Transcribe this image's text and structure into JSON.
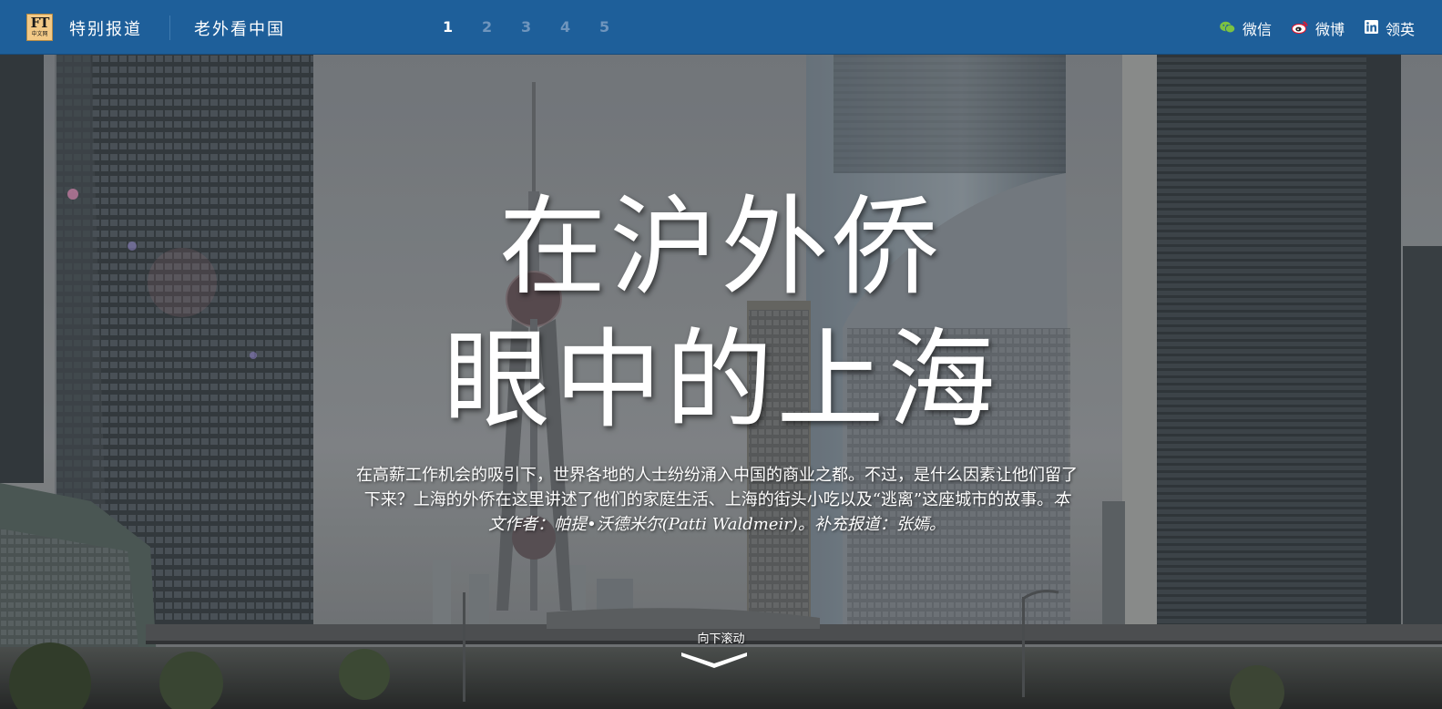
{
  "header": {
    "logo": {
      "text": "FT",
      "subtext": "中文网"
    },
    "section_title": "特别报道",
    "series_title": "老外看中国",
    "pages": [
      "1",
      "2",
      "3",
      "4",
      "5"
    ],
    "active_page": "1",
    "share": [
      {
        "label": "微信",
        "icon": "wechat-icon"
      },
      {
        "label": "微博",
        "icon": "weibo-icon"
      },
      {
        "label": "领英",
        "icon": "linkedin-icon"
      }
    ],
    "colors": {
      "bar": "#1e5f9a",
      "inactive_page": "#6f95bd"
    }
  },
  "hero": {
    "headline_line1": "在沪外侨",
    "headline_line2": "眼中的上海",
    "dek_text": "在高薪工作机会的吸引下，世界各地的人士纷纷涌入中国的商业之都。不过，是什么因素让他们留了下来？上海的外侨在这里讲述了他们的家庭生活、上海的街头小吃以及“逃离”这座城市的故事。",
    "byline": "本文作者：帕提•沃德米尔(Patti Waldmeir)。补充报道：张嫣。",
    "scroll_label": "向下滚动",
    "image_subject": "上海陆家嘴天际线与东方明珠塔"
  }
}
